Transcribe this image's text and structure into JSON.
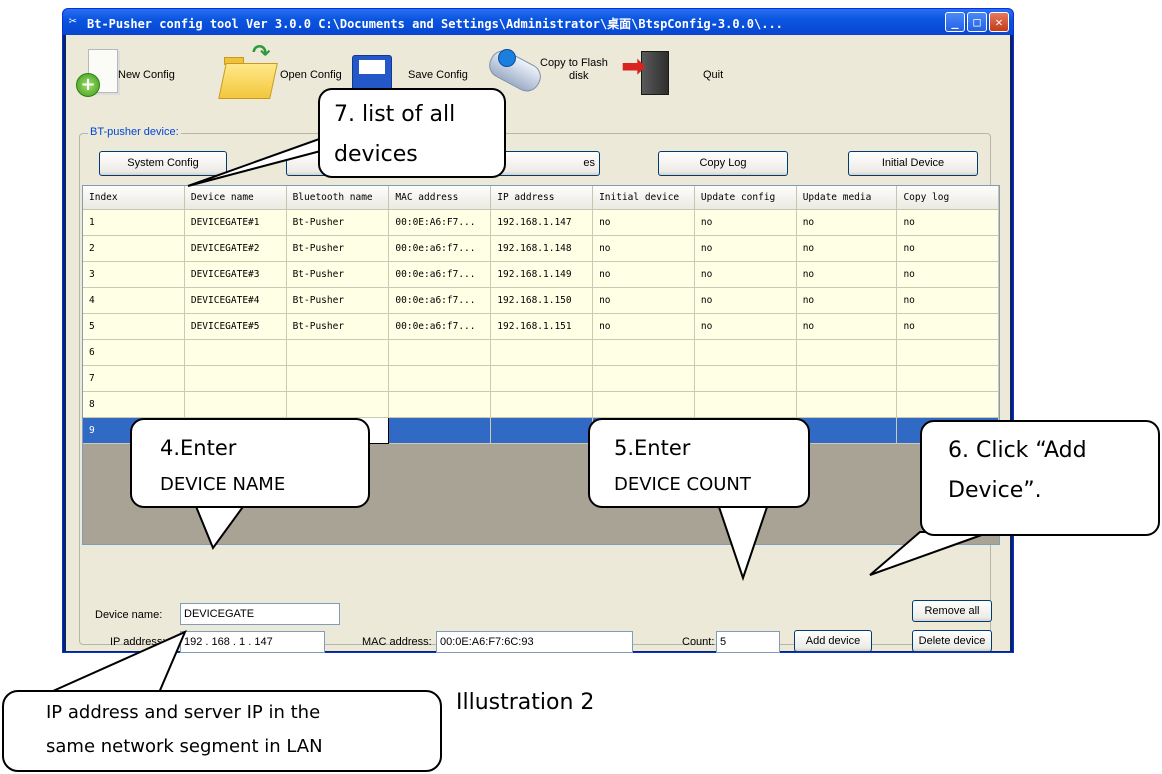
{
  "window": {
    "title": "Bt-Pusher config tool Ver 3.0.0    C:\\Documents and Settings\\Administrator\\桌面\\BtspConfig-3.0.0\\...",
    "minimize": "_",
    "maximize": "□",
    "close": "✕"
  },
  "toolbar": {
    "new_config": "New Config",
    "open_config": "Open Config",
    "save_config": "Save Config",
    "copy_flash_line1": "Copy to Flash",
    "copy_flash_line2": "disk",
    "quit": "Quit"
  },
  "group": {
    "title": "BT-pusher device:",
    "buttons": {
      "system_config": "System Config",
      "update_media_partial": "es",
      "copy_log": "Copy Log",
      "initial_device": "Initial Device"
    }
  },
  "grid": {
    "columns": [
      "Index",
      "Device name",
      "Bluetooth name",
      "MAC address",
      "IP address",
      "Initial device",
      "Update config",
      "Update media",
      "Copy log"
    ],
    "rows": [
      [
        "1",
        "DEVICEGATE#1",
        "Bt-Pusher",
        "00:0E:A6:F7...",
        "192.168.1.147",
        "no",
        "no",
        "no",
        "no"
      ],
      [
        "2",
        "DEVICEGATE#2",
        "Bt-Pusher",
        "00:0e:a6:f7...",
        "192.168.1.148",
        "no",
        "no",
        "no",
        "no"
      ],
      [
        "3",
        "DEVICEGATE#3",
        "Bt-Pusher",
        "00:0e:a6:f7...",
        "192.168.1.149",
        "no",
        "no",
        "no",
        "no"
      ],
      [
        "4",
        "DEVICEGATE#4",
        "Bt-Pusher",
        "00:0e:a6:f7...",
        "192.168.1.150",
        "no",
        "no",
        "no",
        "no"
      ],
      [
        "5",
        "DEVICEGATE#5",
        "Bt-Pusher",
        "00:0e:a6:f7...",
        "192.168.1.151",
        "no",
        "no",
        "no",
        "no"
      ],
      [
        "6",
        "",
        "",
        "",
        "",
        "",
        "",
        "",
        ""
      ],
      [
        "7",
        "",
        "",
        "",
        "",
        "",
        "",
        "",
        ""
      ],
      [
        "8",
        "",
        "",
        "",
        "",
        "",
        "",
        "",
        ""
      ],
      [
        "9",
        "",
        "",
        "",
        "",
        "",
        "",
        "",
        ""
      ]
    ],
    "selected_row": 9
  },
  "form": {
    "device_name_label": "Device name:",
    "device_name_value": "DEVICEGATE",
    "ip_label": "IP address:",
    "ip_value": "192  .  168  .   1   .  147",
    "mac_label": "MAC address:",
    "mac_value": "00:0E:A6:F7:6C:93",
    "count_label": "Count:",
    "count_value": "5",
    "remove_all": "Remove all",
    "add_device": "Add device",
    "delete_device": "Delete device"
  },
  "callouts": {
    "c7_line1": "7.  list   of   all",
    "c7_line2": "devices",
    "c4_line1": "4.Enter",
    "c4_line2": "DEVICE NAME",
    "c5_line1": "5.Enter",
    "c5_line2": "DEVICE COUNT",
    "c6_line1": "6.  Click  “Add",
    "c6_line2": "Device”.",
    "ip_line1": "IP address and server IP in the",
    "ip_line2": "same network segment in LAN"
  },
  "caption": "Illustration 2",
  "colors": {
    "titlebar": "#0a55e0",
    "window_bg": "#ece9d8",
    "grid_row_bg": "#ffffe6",
    "selection": "#316ac5",
    "group_title": "#0046d5"
  }
}
